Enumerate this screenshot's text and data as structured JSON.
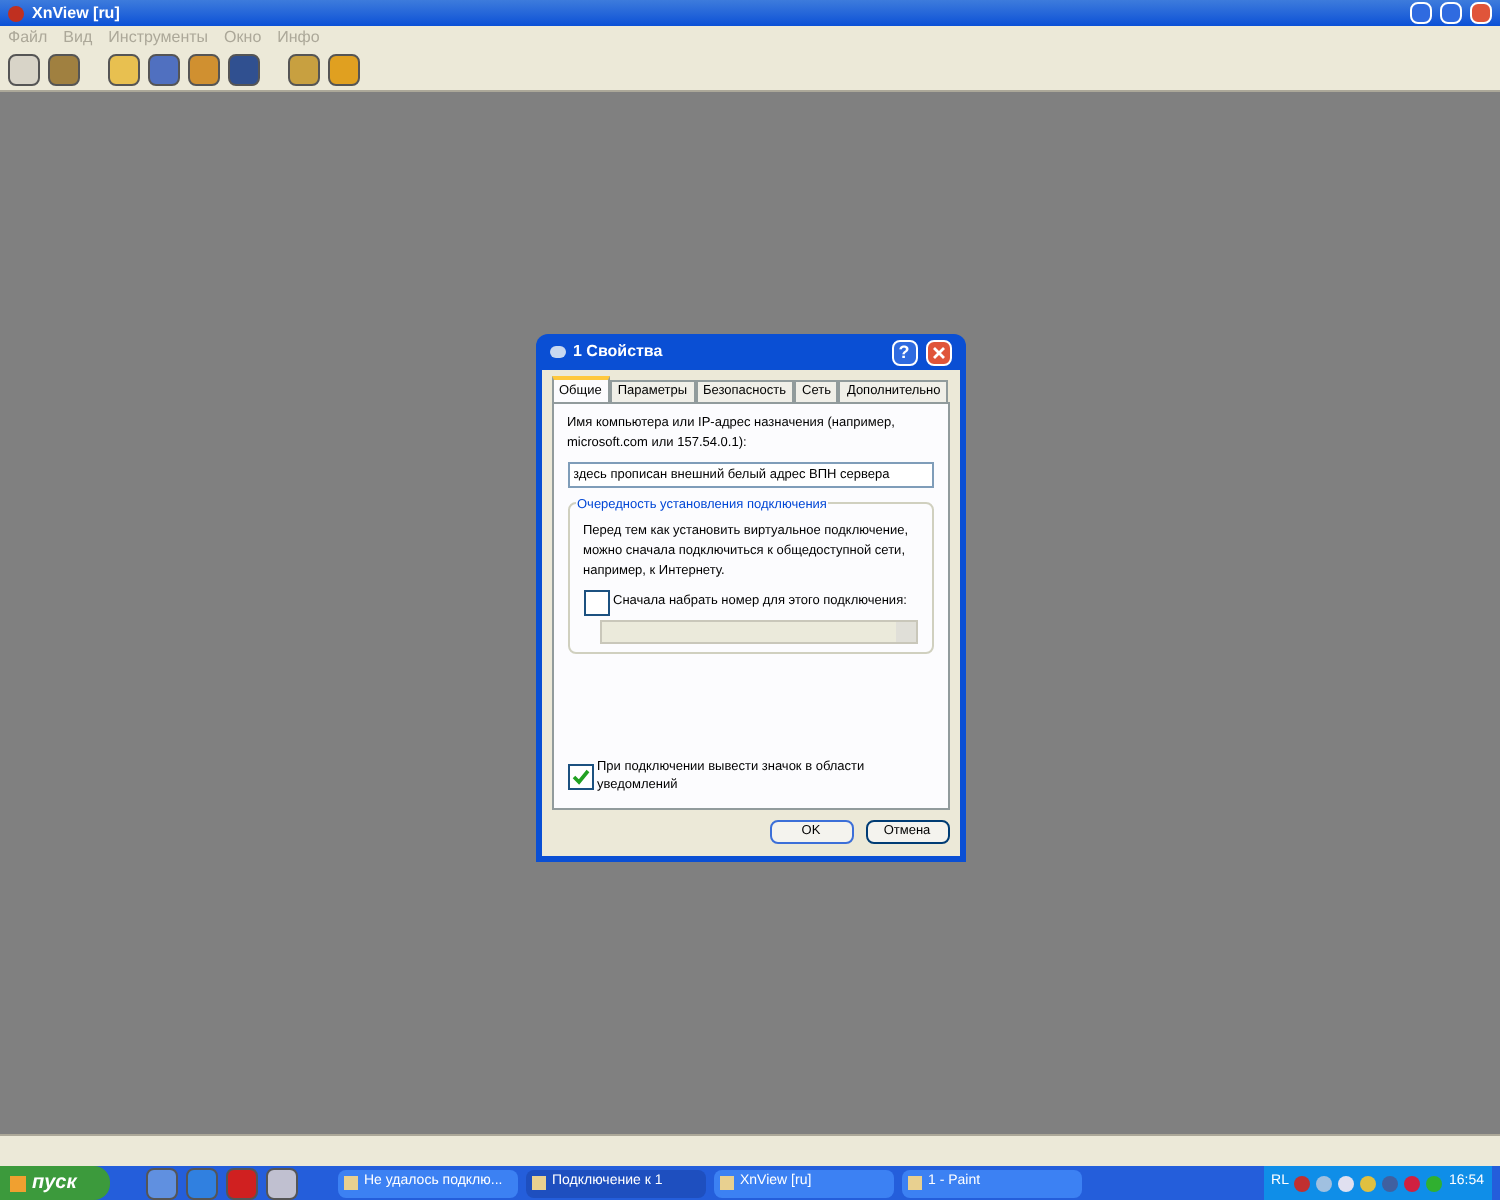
{
  "window": {
    "title": "XnView [ru]"
  },
  "menu": [
    {
      "label": "Файл",
      "disabled": true
    },
    {
      "label": "Вид",
      "disabled": true
    },
    {
      "label": "Инструменты",
      "disabled": true
    },
    {
      "label": "Окно",
      "disabled": true
    },
    {
      "label": "Инфо",
      "disabled": true
    }
  ],
  "dialog": {
    "title": "1 Свойства",
    "help": "?",
    "tabs": [
      {
        "label": "Общие",
        "selected": true
      },
      {
        "label": "Параметры",
        "selected": false
      },
      {
        "label": "Безопасность",
        "selected": false
      },
      {
        "label": "Сеть",
        "selected": false
      },
      {
        "label": "Дополнительно",
        "selected": false
      }
    ],
    "host_label": "Имя компьютера или IP-адрес назначения (например, microsoft.com или 157.54.0.1):",
    "host_value": "здесь прописан внешний белый адрес ВПН сервера",
    "group_title": "Очередность установления подключения",
    "group_text": "Перед тем как установить виртуальное подключение, можно сначала подключиться к общедоступной сети, например, к Интернету.",
    "dial_first": {
      "label": "Сначала набрать номер для этого подключения:",
      "checked": false
    },
    "dial_select": {
      "disabled": true
    },
    "show_icon": {
      "label": "При подключении вывести значок в области уведомлений",
      "checked": true
    },
    "buttons": [
      "OK",
      "Отмена"
    ]
  },
  "taskbar": {
    "start": "пуск",
    "tasks": [
      {
        "label": "Не удалось подклю...",
        "selected": false
      },
      {
        "label": "Подключение к 1",
        "selected": true
      },
      {
        "label": "XnView [ru]",
        "selected": false
      },
      {
        "label": "1 - Paint",
        "selected": false
      }
    ],
    "lang": "RL",
    "clock": "16:54"
  }
}
